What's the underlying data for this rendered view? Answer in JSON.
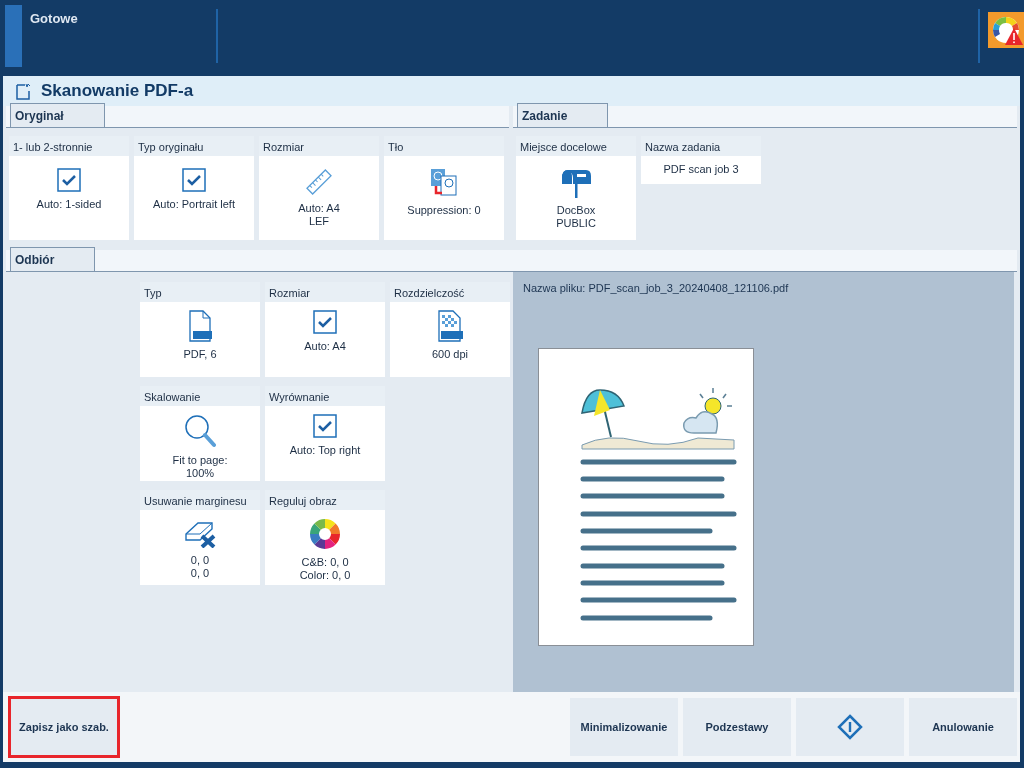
{
  "status_bar": {
    "text": "Gotowe"
  },
  "title": "Skanowanie PDF-a",
  "top_sections": [
    {
      "tab": "Oryginał",
      "tiles": [
        {
          "label": "1- lub 2-stronnie",
          "kind": "check",
          "lines": [
            "Auto: 1-sided"
          ]
        },
        {
          "label": "Typ oryginału",
          "kind": "check",
          "lines": [
            "Auto: Portrait left"
          ]
        },
        {
          "label": "Rozmiar",
          "kind": "ruler",
          "lines": [
            "Auto: A4",
            "LEF"
          ]
        },
        {
          "label": "Tło",
          "kind": "background",
          "lines": [
            "Suppression: 0"
          ]
        }
      ]
    },
    {
      "tab": "Zadanie",
      "tiles": [
        {
          "label": "Miejsce docelowe",
          "kind": "mailbox",
          "lines": [
            "DocBox",
            "PUBLIC"
          ]
        },
        {
          "label": "Nazwa zadania",
          "kind": "text",
          "lines": [
            "PDF scan job 3"
          ]
        }
      ]
    }
  ],
  "output_section": {
    "tab": "Odbiór",
    "tile_rows": [
      [
        {
          "label": "Typ",
          "kind": "pdf",
          "lines": [
            "PDF, 6"
          ]
        },
        {
          "label": "Rozmiar",
          "kind": "check",
          "lines": [
            "Auto: A4"
          ]
        },
        {
          "label": "Rozdzielczość",
          "kind": "dpi",
          "lines": [
            "600 dpi"
          ]
        }
      ],
      [
        {
          "label": "Skalowanie",
          "kind": "magnifier",
          "lines": [
            "Fit to page:",
            "100%"
          ]
        },
        {
          "label": "Wyrównanie",
          "kind": "check",
          "lines": [
            "Auto: Top right"
          ]
        }
      ],
      [
        {
          "label": "Usuwanie marginesu",
          "kind": "eraser",
          "lines": [
            "0, 0",
            "0, 0"
          ]
        },
        {
          "label": "Reguluj obraz",
          "kind": "colorwheel",
          "lines": [
            "C&B: 0, 0",
            "Color: 0, 0"
          ]
        }
      ]
    ],
    "file_name": "Nazwa pliku: PDF_scan_job_3_20240408_121106.pdf"
  },
  "footer_buttons": [
    {
      "kind": "text",
      "label": "Zapisz jako szab.",
      "highlighted": true
    },
    {
      "kind": "text",
      "label": "Minimalizowanie",
      "highlighted": false
    },
    {
      "kind": "text",
      "label": "Podzestawy",
      "highlighted": false
    },
    {
      "kind": "info",
      "highlighted": false
    },
    {
      "kind": "text",
      "label": "Anulowanie",
      "highlighted": false
    }
  ]
}
